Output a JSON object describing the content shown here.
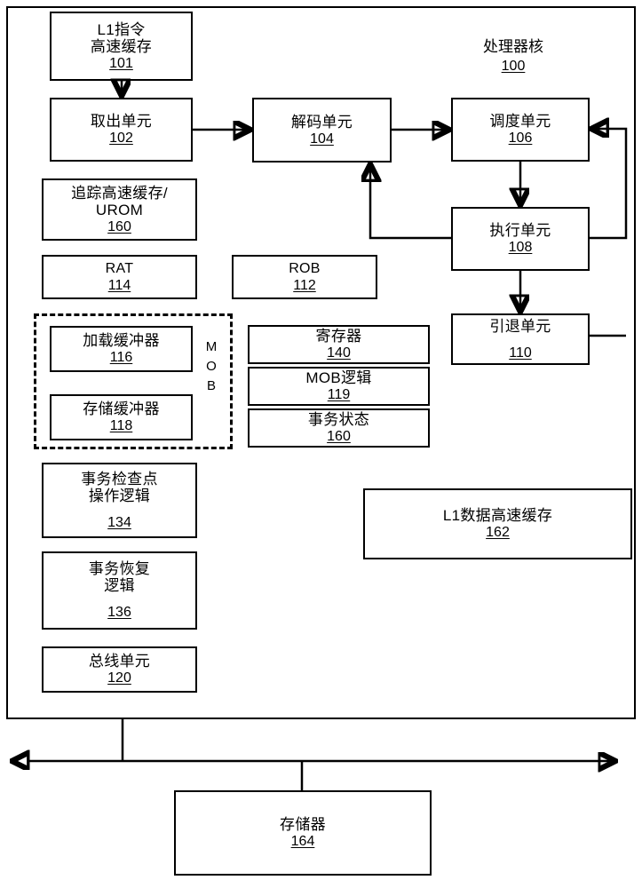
{
  "diagram": {
    "kind": "processor-core-block-diagram",
    "core_title": {
      "label": "处理器核",
      "number": "100"
    },
    "mob_group_label": "M\nO\nB",
    "blocks": {
      "l1_instruction_cache": {
        "label": "L1指令\n高速缓存",
        "number": "101"
      },
      "fetch_unit": {
        "label": "取出单元",
        "number": "102"
      },
      "trace_cache_urom": {
        "label": "追踪高速缓存/\nUROM",
        "number": "160"
      },
      "rat": {
        "label": "RAT",
        "number": "114"
      },
      "load_buffer": {
        "label": "加载缓冲器",
        "number": "116"
      },
      "store_buffer": {
        "label": "存储缓冲器",
        "number": "118"
      },
      "txn_checkpoint_logic": {
        "label": "事务检查点\n操作逻辑",
        "number": "134"
      },
      "txn_recovery_logic": {
        "label": "事务恢复\n逻辑",
        "number": "136"
      },
      "bus_unit": {
        "label": "总线单元",
        "number": "120"
      },
      "decode_unit": {
        "label": "解码单元",
        "number": "104"
      },
      "rob": {
        "label": "ROB",
        "number": "112"
      },
      "registers": {
        "label": "寄存器",
        "number": "140"
      },
      "mob_logic": {
        "label": "MOB逻辑",
        "number": "119"
      },
      "transaction_state": {
        "label": "事务状态",
        "number": "160"
      },
      "schedule_unit": {
        "label": "调度单元",
        "number": "106"
      },
      "execution_unit": {
        "label": "执行单元",
        "number": "108"
      },
      "retire_unit": {
        "label": "引退单元",
        "number": "110"
      },
      "l1_data_cache": {
        "label": "L1数据高速缓存",
        "number": "162"
      },
      "memory": {
        "label": "存储器",
        "number": "164"
      }
    },
    "colors": {
      "stroke": "#000000",
      "background": "#ffffff"
    }
  }
}
